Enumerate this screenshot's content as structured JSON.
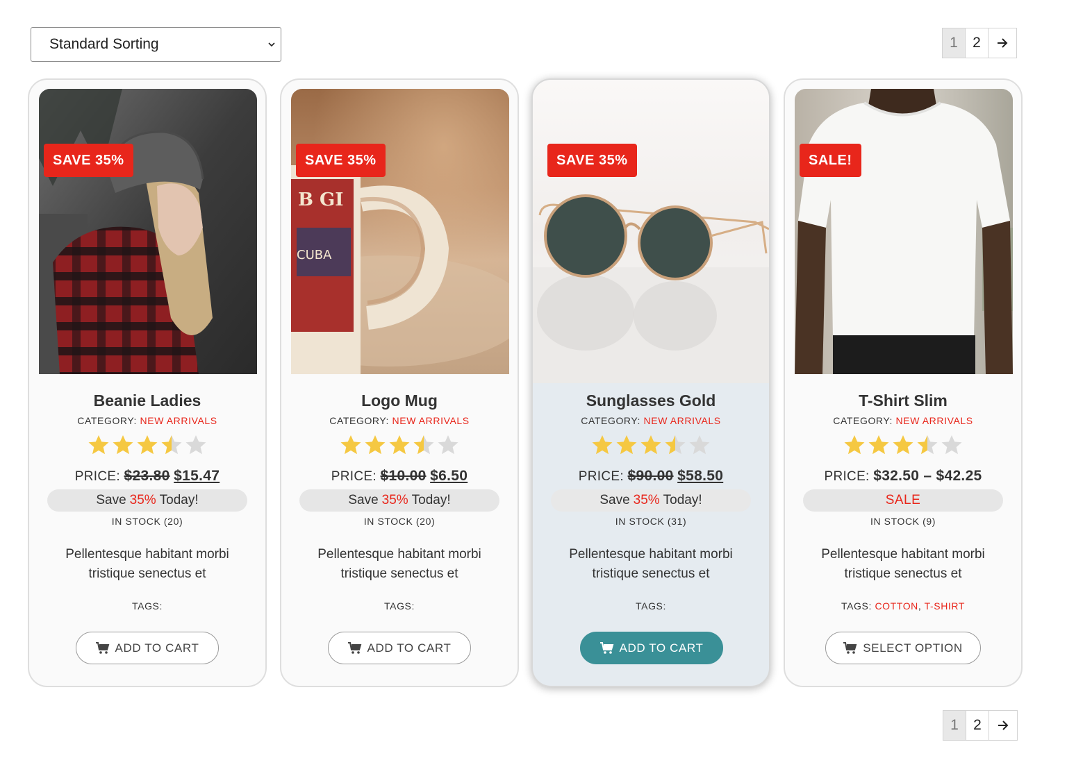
{
  "sorting": {
    "selected": "Standard Sorting"
  },
  "pagination": {
    "pages": [
      "1",
      "2"
    ],
    "current": "1",
    "next": "→"
  },
  "products": [
    {
      "badge": "SAVE 35%",
      "title": "Beanie Ladies",
      "category_label": "CATEGORY:",
      "category": "NEW ARRIVALS",
      "rating": 3.5,
      "price_label": "PRICE:",
      "old_price": "$23.80",
      "new_price": "$15.47",
      "save_prefix": "Save",
      "save_pct": "35%",
      "save_suffix": "Today!",
      "stock": "IN STOCK (20)",
      "description": "Pellentesque habitant morbi tristique senectus et",
      "tags_label": "TAGS:",
      "button": "ADD TO CART"
    },
    {
      "badge": "SAVE 35%",
      "title": "Logo Mug",
      "category_label": "CATEGORY:",
      "category": "NEW ARRIVALS",
      "rating": 3.5,
      "price_label": "PRICE:",
      "old_price": "$10.00",
      "new_price": "$6.50",
      "save_prefix": "Save",
      "save_pct": "35%",
      "save_suffix": "Today!",
      "stock": "IN STOCK (20)",
      "description": "Pellentesque habitant morbi tristique senectus et",
      "tags_label": "TAGS:",
      "button": "ADD TO CART"
    },
    {
      "badge": "SAVE 35%",
      "title": "Sunglasses Gold",
      "category_label": "CATEGORY:",
      "category": "NEW ARRIVALS",
      "rating": 3.5,
      "price_label": "PRICE:",
      "old_price": "$90.00",
      "new_price": "$58.50",
      "save_prefix": "Save",
      "save_pct": "35%",
      "save_suffix": "Today!",
      "stock": "IN STOCK (31)",
      "description": "Pellentesque habitant morbi tristique senectus et",
      "tags_label": "TAGS:",
      "button": "ADD TO CART"
    },
    {
      "badge": "SALE!",
      "title": "T-Shirt Slim",
      "category_label": "CATEGORY:",
      "category": "NEW ARRIVALS",
      "rating": 3.5,
      "price_label": "PRICE:",
      "price_range": "$32.50 – $42.25",
      "sale_text": "SALE",
      "stock": "IN STOCK (9)",
      "description": "Pellentesque habitant morbi tristique senectus et",
      "tags_label": "TAGS:",
      "tags": [
        "COTTON",
        "T-SHIRT"
      ],
      "button": "SELECT OPTION"
    }
  ],
  "colors": {
    "accent_red": "#e8261b",
    "button_teal": "#3a9097",
    "star_gold": "#f5c842",
    "star_empty": "#d9d9d9"
  }
}
